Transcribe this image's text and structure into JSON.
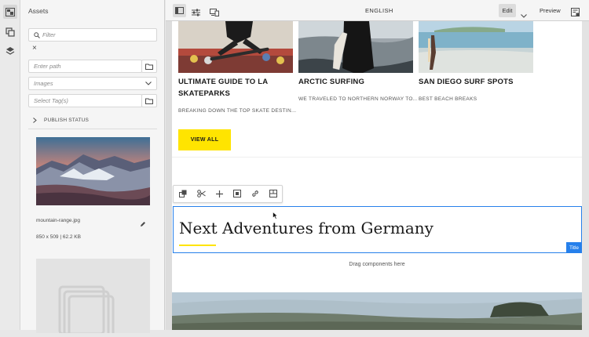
{
  "left_rail": {
    "icons": [
      "assets-panel-icon",
      "components-icon",
      "layers-icon"
    ]
  },
  "assets_panel": {
    "title": "Assets",
    "filter_placeholder": "Filter",
    "clear_symbol": "×",
    "path_placeholder": "Enter path",
    "type_select_value": "Images",
    "tags_placeholder": "Select Tag(s)",
    "publish_status_label": "PUBLISH STATUS",
    "asset": {
      "name": "mountain-range.jpg",
      "meta": "850 x 509 | 62.2 KB"
    }
  },
  "toolbar": {
    "language": "ENGLISH",
    "edit_label": "Edit",
    "preview_label": "Preview"
  },
  "cards": [
    {
      "title_lines": [
        "ULTIMATE GUIDE TO LA",
        "SKATEPARKS"
      ],
      "description": "BREAKING DOWN THE TOP SKATE DESTIN..."
    },
    {
      "title_lines": [
        "ARCTIC SURFING"
      ],
      "description": "WE TRAVELED TO NORTHERN NORWAY TO..."
    },
    {
      "title_lines": [
        "SAN DIEGO SURF SPOTS"
      ],
      "description": "BEST BEACH BREAKS"
    }
  ],
  "view_all_label": "VIEW ALL",
  "title_component": {
    "text": "Next Adventures from Germany",
    "badge": "Title"
  },
  "drop_zone": "Drag components here",
  "colors": {
    "accent_yellow": "#ffe400",
    "selection_blue": "#2680eb"
  }
}
